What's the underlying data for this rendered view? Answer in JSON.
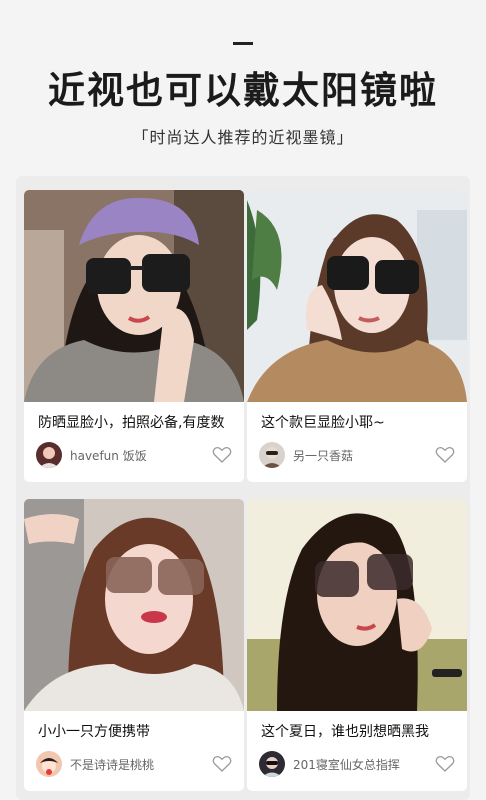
{
  "header": {
    "title": "近视也可以戴太阳镜啦",
    "subtitle": "「时尚达人推荐的近视墨镜」"
  },
  "cards": [
    {
      "caption": "防晒显脸小，拍照必备,有度数",
      "author": "havefun 饭饭",
      "avatar_icon": "user-avatar-icon",
      "heart_icon": "heart-outline-icon"
    },
    {
      "caption": "这个款巨显脸小耶~",
      "author": "另一只香菇",
      "avatar_icon": "user-avatar-icon",
      "heart_icon": "heart-outline-icon"
    },
    {
      "caption": "小小一只方便携带",
      "author": "不是诗诗是桃桃",
      "avatar_icon": "user-avatar-icon",
      "heart_icon": "heart-outline-icon"
    },
    {
      "caption": "这个夏日，谁也别想晒黑我",
      "author": "201寝室仙女总指挥",
      "avatar_icon": "user-avatar-icon",
      "heart_icon": "heart-outline-icon"
    }
  ],
  "colors": {
    "background": "#f4f4f4",
    "panel": "#ececec",
    "card": "#ffffff",
    "heart_stroke": "#9a9a9a"
  }
}
